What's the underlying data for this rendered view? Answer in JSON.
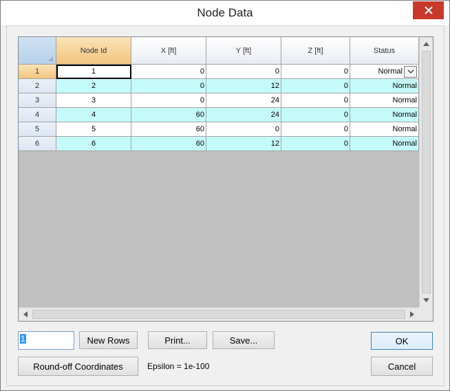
{
  "window": {
    "title": "Node Data"
  },
  "grid": {
    "columns": [
      "Node Id",
      "X [ft]",
      "Y [ft]",
      "Z [ft]",
      "Status"
    ],
    "rows": [
      {
        "row": "1",
        "node_id": "1",
        "x": "0",
        "y": "0",
        "z": "0",
        "status": "Normal"
      },
      {
        "row": "2",
        "node_id": "2",
        "x": "0",
        "y": "12",
        "z": "0",
        "status": "Normal"
      },
      {
        "row": "3",
        "node_id": "3",
        "x": "0",
        "y": "24",
        "z": "0",
        "status": "Normal"
      },
      {
        "row": "4",
        "node_id": "4",
        "x": "60",
        "y": "24",
        "z": "0",
        "status": "Normal"
      },
      {
        "row": "5",
        "node_id": "5",
        "x": "60",
        "y": "0",
        "z": "0",
        "status": "Normal"
      },
      {
        "row": "6",
        "node_id": "6",
        "x": "60",
        "y": "12",
        "z": "0",
        "status": "Normal"
      }
    ]
  },
  "controls": {
    "row_count_value": "1",
    "new_rows_label": "New Rows",
    "print_label": "Print...",
    "save_label": "Save...",
    "ok_label": "OK",
    "round_off_label": "Round-off Coordinates",
    "epsilon_text": "Epsilon = 1e-100",
    "cancel_label": "Cancel"
  },
  "colors": {
    "close_button": "#c7392b",
    "row_alt": "#c4fbfa",
    "header_active": "#f2c47e"
  }
}
